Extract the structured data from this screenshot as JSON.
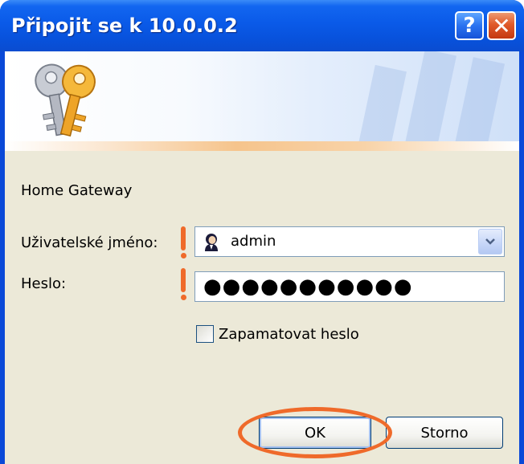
{
  "window": {
    "title": "Připojit se k 10.0.0.2"
  },
  "titlebar": {
    "help_glyph": "?",
    "close_glyph": "✕"
  },
  "dialog": {
    "server_name": "Home Gateway",
    "username_label": "Uživatelské jméno:",
    "username_value": "admin",
    "password_label": "Heslo:",
    "password_value": "●●●●●●●●●●●",
    "remember_label": "Zapamatovat heslo",
    "remember_checked": false
  },
  "buttons": {
    "ok_label": "OK",
    "cancel_label": "Storno"
  },
  "icons": {
    "banner": "keys-icon",
    "user": "user-icon",
    "dropdown": "chevron-down-icon",
    "help": "help-icon",
    "close": "close-icon"
  },
  "colors": {
    "titlebar": "#0a5ae8",
    "client": "#ece9d8",
    "annotation": "#ef6a2a",
    "button_border": "#003c74"
  }
}
